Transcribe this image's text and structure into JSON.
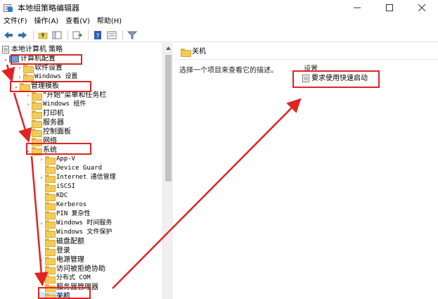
{
  "window": {
    "title": "本地组策略编辑器"
  },
  "menu": [
    "文件(F)",
    "操作(A)",
    "查看(V)",
    "帮助(H)"
  ],
  "toolbar": {
    "buttons": [
      "back-arrow-icon",
      "forward-arrow-icon",
      "up-folder-icon",
      "show-hide-tree-icon",
      "export-icon",
      "help-icon",
      "properties-icon",
      "filter-icon"
    ]
  },
  "tree": {
    "root": "本地计算机 策略",
    "computer_config": "计算机配置",
    "software_settings": "软件设置",
    "windows_settings": "Windows 设置",
    "admin_templates": "管理模板",
    "start_menu": "“开始”菜单和任务栏",
    "windows_components": "Windows 组件",
    "printers": "打印机",
    "server": "服务器",
    "control_panel": "控制面板",
    "network": "网络",
    "system": "系统",
    "system_children": [
      "App-V",
      "Device Guard",
      "Internet 通信管理",
      "iSCSI",
      "KDC",
      "Kerberos",
      "PIN 复杂性",
      "Windows 时间服务",
      "Windows 文件保护",
      "磁盘配额",
      "登录",
      "电源管理",
      "访问被拒绝协助",
      "分布式 COM",
      "服务器管理器",
      "关机"
    ]
  },
  "right_pane": {
    "folder_title": "关机",
    "description_prompt": "选择一个项目来查看它的描述。",
    "column_header": "设置",
    "setting_item": "要求使用快速启动"
  },
  "colors": {
    "annotation_red": "#e02424",
    "folder_yellow": "#f3cb59"
  }
}
